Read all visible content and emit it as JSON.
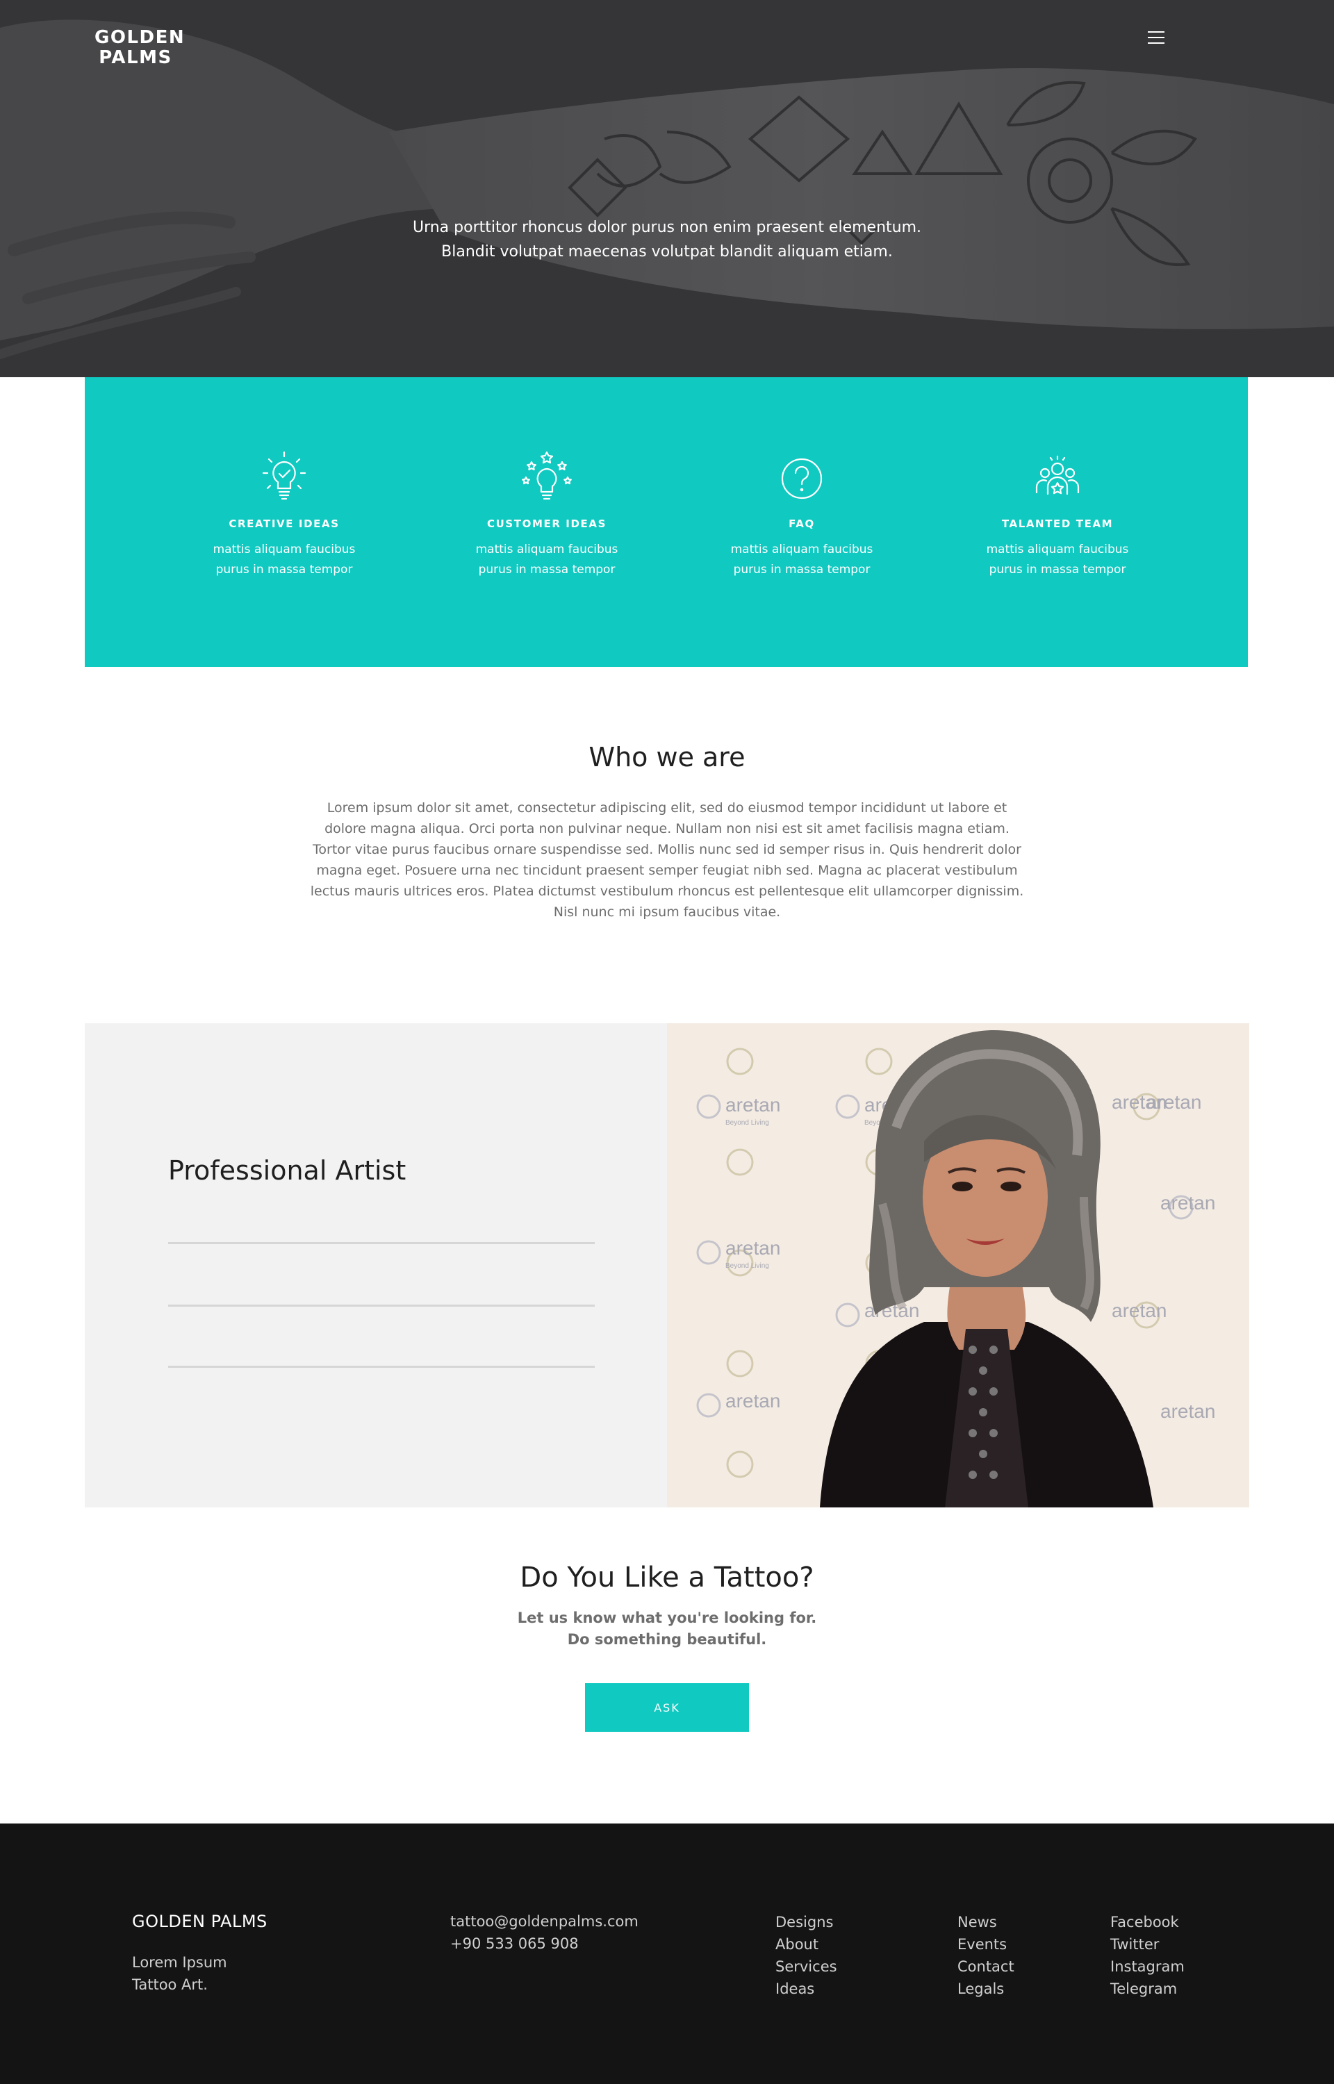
{
  "header": {
    "brand_line1": "GOLDEN",
    "brand_line2": "PALMS",
    "menu_icon": "hamburger-icon"
  },
  "hero": {
    "line1": "Urna porttitor rhoncus dolor purus non enim praesent elementum.",
    "line2": "Blandit volutpat maecenas volutpat blandit aliquam etiam."
  },
  "features": {
    "background": "#10c9c1",
    "items": [
      {
        "icon": "lightbulb-check-icon",
        "title": "CREATIVE IDEAS",
        "line1": "mattis aliquam faucibus",
        "line2": "purus in massa tempor"
      },
      {
        "icon": "lightbulb-stars-icon",
        "title": "CUSTOMER IDEAS",
        "line1": "mattis aliquam faucibus",
        "line2": "purus in massa tempor"
      },
      {
        "icon": "question-circle-icon",
        "title": "FAQ",
        "line1": "mattis aliquam faucibus",
        "line2": "purus in massa tempor"
      },
      {
        "icon": "team-star-icon",
        "title": "TALANTED TEAM",
        "line1": "mattis aliquam faucibus",
        "line2": "purus in massa tempor"
      }
    ]
  },
  "about": {
    "title": "Who we are",
    "body": "Lorem ipsum dolor sit amet, consectetur adipiscing elit, sed do eiusmod tempor incididunt ut labore et dolore magna aliqua. Orci porta non pulvinar neque. Nullam non nisi est sit amet facilisis magna etiam. Tortor vitae purus faucibus ornare suspendisse sed. Mollis nunc sed id semper risus in. Quis hendrerit dolor magna eget. Posuere urna nec tincidunt praesent semper feugiat nibh sed. Magna ac placerat vestibulum lectus mauris ultrices eros. Platea dictumst vestibulum rhoncus est pellentesque elit ullamcorper dignissim. Nisl nunc mi ipsum faucibus vitae."
  },
  "artist": {
    "title": "Professional Artist",
    "backdrop_text": "aretan",
    "backdrop_sub": "Beyond Living"
  },
  "cta": {
    "title": "Do You Like a Tattoo?",
    "line1": "Let us know what you're looking for.",
    "line2": "Do something beautiful.",
    "button": "ASK",
    "accent": "#10c9c1"
  },
  "footer": {
    "brand": "GOLDEN PALMS",
    "tag_line1": "Lorem Ipsum",
    "tag_line2": "Tattoo Art.",
    "email": "tattoo@goldenpalms.com",
    "phone": "+90 533 065 908",
    "columns": [
      [
        "Designs",
        "About",
        "Services",
        "Ideas"
      ],
      [
        "News",
        "Events",
        "Contact",
        "Legals"
      ],
      [
        "Facebook",
        "Twitter",
        "Instagram",
        "Telegram"
      ]
    ],
    "background": "#141414"
  }
}
